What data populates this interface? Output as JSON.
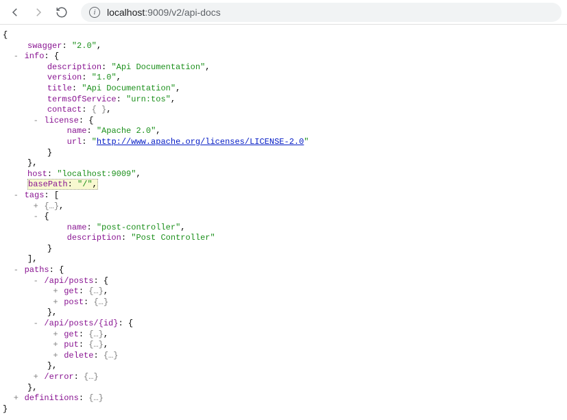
{
  "url": {
    "host": "localhost",
    "port": ":9009",
    "path": "/v2/api-docs"
  },
  "json": {
    "swagger": "2.0",
    "info": {
      "description": "Api Documentation",
      "version": "1.0",
      "title": "Api Documentation",
      "termsOfService": "urn:tos",
      "contact_display": "{ }",
      "license": {
        "name": "Apache 2.0",
        "url": "http://www.apache.org/licenses/LICENSE-2.0"
      }
    },
    "host": "localhost:9009",
    "basePath": "/",
    "tags_open_item": {
      "name": "post-controller",
      "description": "Post Controller"
    },
    "paths": {
      "p1": "/api/posts",
      "p1_methods": [
        "get",
        "post"
      ],
      "p2": "/api/posts/{id}",
      "p2_methods": [
        "get",
        "put",
        "delete"
      ],
      "p3": "/error"
    },
    "definitions_label": "definitions",
    "ellipsis": "{…}"
  },
  "labels": {
    "swagger": "swagger",
    "info": "info",
    "description": "description",
    "version": "version",
    "title": "title",
    "termsOfService": "termsOfService",
    "contact": "contact",
    "license": "license",
    "name": "name",
    "url": "url",
    "host": "host",
    "basePath": "basePath",
    "tags": "tags",
    "paths": "paths",
    "get": "get",
    "post": "post",
    "put": "put",
    "delete": "delete"
  }
}
